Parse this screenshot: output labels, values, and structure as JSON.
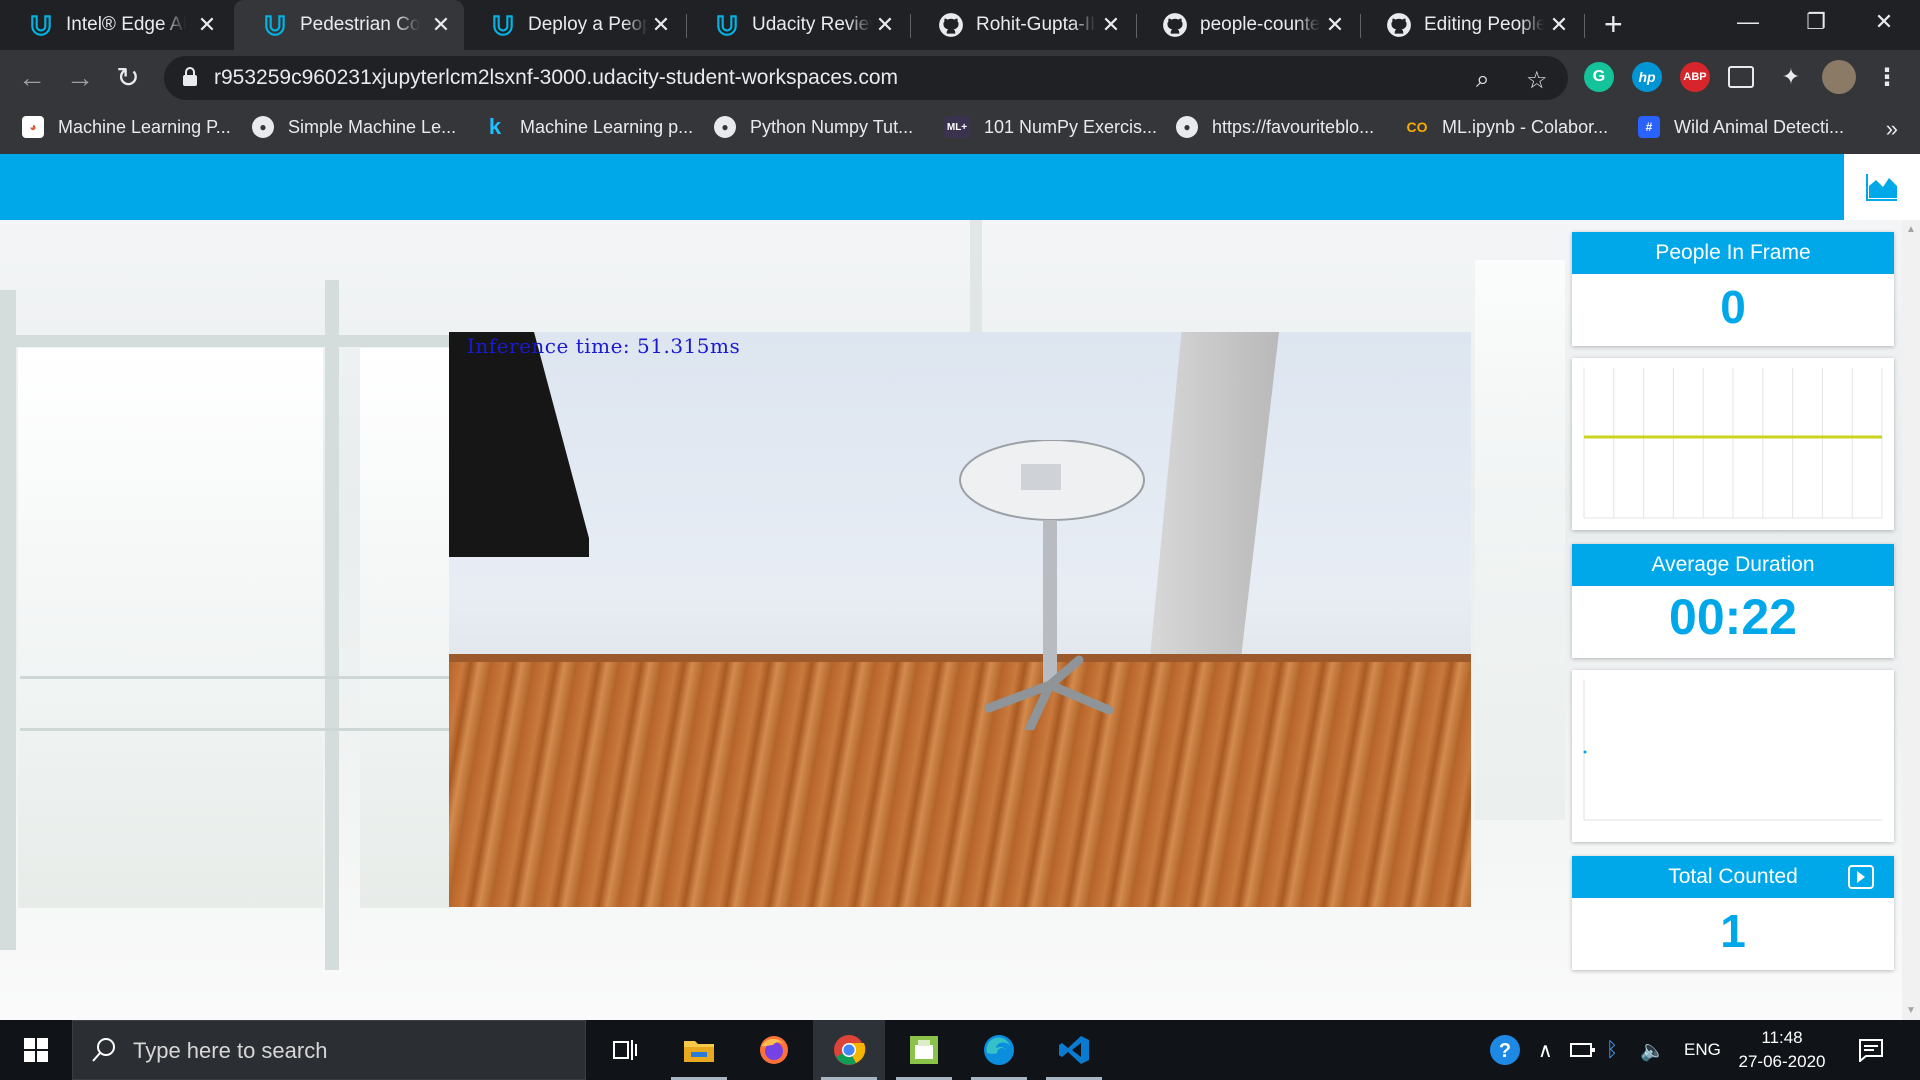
{
  "browser": {
    "tabs": [
      {
        "title": "Intel® Edge AI f",
        "icon": "udacity-icon",
        "active": false
      },
      {
        "title": "Pedestrian Coun",
        "icon": "udacity-icon",
        "active": true
      },
      {
        "title": "Deploy a People",
        "icon": "udacity-icon",
        "active": false
      },
      {
        "title": "Udacity Reviews",
        "icon": "udacity-icon",
        "active": false
      },
      {
        "title": "Rohit-Gupta-IIC",
        "icon": "github-icon",
        "active": false
      },
      {
        "title": "people-counter",
        "icon": "github-icon",
        "active": false
      },
      {
        "title": "Editing People_C",
        "icon": "github-icon",
        "active": false
      }
    ],
    "tab_close_glyph": "✕",
    "new_tab_glyph": "+",
    "url": "r953259c960231xjupyterlcm2lsxnf-3000.udacity-student-workspaces.com",
    "extensions": [
      "grammarly-icon",
      "hp-icon",
      "adblock-plus-icon",
      "media-icon",
      "puzzle-icon",
      "profile-avatar",
      "menu-icon"
    ],
    "abp_label": "ABP",
    "hp_label": "hp",
    "bookmarks": [
      {
        "label": "Machine Learning P...",
        "icon": "machine-learning-icon"
      },
      {
        "label": "Simple Machine Le...",
        "icon": "globe-icon"
      },
      {
        "label": "Machine Learning p...",
        "icon": "kaggle-icon"
      },
      {
        "label": "Python Numpy Tut...",
        "icon": "globe-icon"
      },
      {
        "label": "101 NumPy Exercis...",
        "icon": "ml-plus-icon"
      },
      {
        "label": "https://favouriteblo...",
        "icon": "globe-icon"
      },
      {
        "label": "ML.ipynb - Colabor...",
        "icon": "colab-icon"
      },
      {
        "label": "Wild Animal Detecti...",
        "icon": "hashnode-icon"
      }
    ],
    "bookmarks_more": "»"
  },
  "app": {
    "video": {
      "overlay_text": "Inference time: 51.315ms"
    },
    "stats": {
      "people_in_frame": {
        "title": "People In Frame",
        "value": "0"
      },
      "average_duration": {
        "title": "Average Duration",
        "value": "00:22"
      },
      "total_counted": {
        "title": "Total Counted",
        "value": "1"
      }
    }
  },
  "colors": {
    "accent": "#00a8ea",
    "chart_line": "#c9d41a",
    "overlay_text": "#1a1ad0"
  },
  "taskbar": {
    "search_placeholder": "Type here to search",
    "apps": [
      "task-view-icon",
      "file-explorer-icon",
      "firefox-icon",
      "chrome-icon",
      "file-manager-icon",
      "edge-icon",
      "vscode-icon"
    ],
    "language": "ENG",
    "time": "11:48",
    "date": "27-06-2020"
  }
}
